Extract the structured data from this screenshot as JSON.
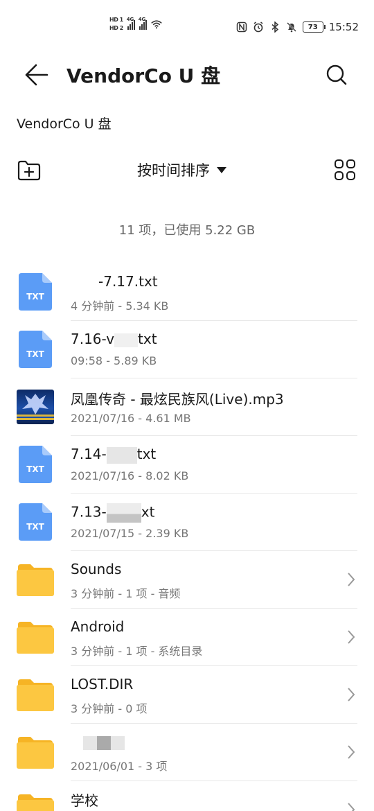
{
  "status_bar": {
    "hd1": "HD 1",
    "hd2": "HD 2",
    "net1": "4G",
    "net2": "4G",
    "battery": "73",
    "time": "15:52",
    "icons": [
      "nfc-icon",
      "alarm-icon",
      "bluetooth-icon",
      "mute-icon",
      "wifi-icon"
    ]
  },
  "header": {
    "title": "VendorCo U 盘"
  },
  "breadcrumb": "VendorCo U 盘",
  "toolbar": {
    "sort_label": "按时间排序"
  },
  "summary": "11 项，已使用 5.22 GB",
  "files": [
    {
      "type": "txt",
      "name_suffix": "-7.17.txt",
      "meta": "4 分钟前 - 5.34 KB",
      "icon_label": "TXT"
    },
    {
      "type": "txt",
      "name_prefix": "7.16-v",
      "name_suffix": "txt",
      "meta": "09:58 - 5.89 KB",
      "icon_label": "TXT"
    },
    {
      "type": "mp3",
      "name": "凤凰传奇 - 最炫民族风(Live).mp3",
      "meta": "2021/07/16 - 4.61 MB"
    },
    {
      "type": "txt",
      "name_prefix": "7.14-",
      "name_suffix": "txt",
      "meta": "2021/07/16 - 8.02 KB",
      "icon_label": "TXT"
    },
    {
      "type": "txt",
      "name_prefix": "7.13-",
      "name_suffix": "xt",
      "meta": "2021/07/15 - 2.39 KB",
      "icon_label": "TXT"
    }
  ],
  "folders": [
    {
      "name": "Sounds",
      "meta": "3 分钟前 - 1 项 - 音频"
    },
    {
      "name": "Android",
      "meta": "3 分钟前 - 1 项 - 系统目录"
    },
    {
      "name": "LOST.DIR",
      "meta": "3 分钟前 - 0 项"
    },
    {
      "name": "",
      "meta": "2021/06/01 - 3 项"
    },
    {
      "name": "学校",
      "meta": ""
    }
  ],
  "colors": {
    "txt_icon": "#5b9cf6",
    "folder": "#fcc741",
    "folder_tab": "#f6b425"
  }
}
